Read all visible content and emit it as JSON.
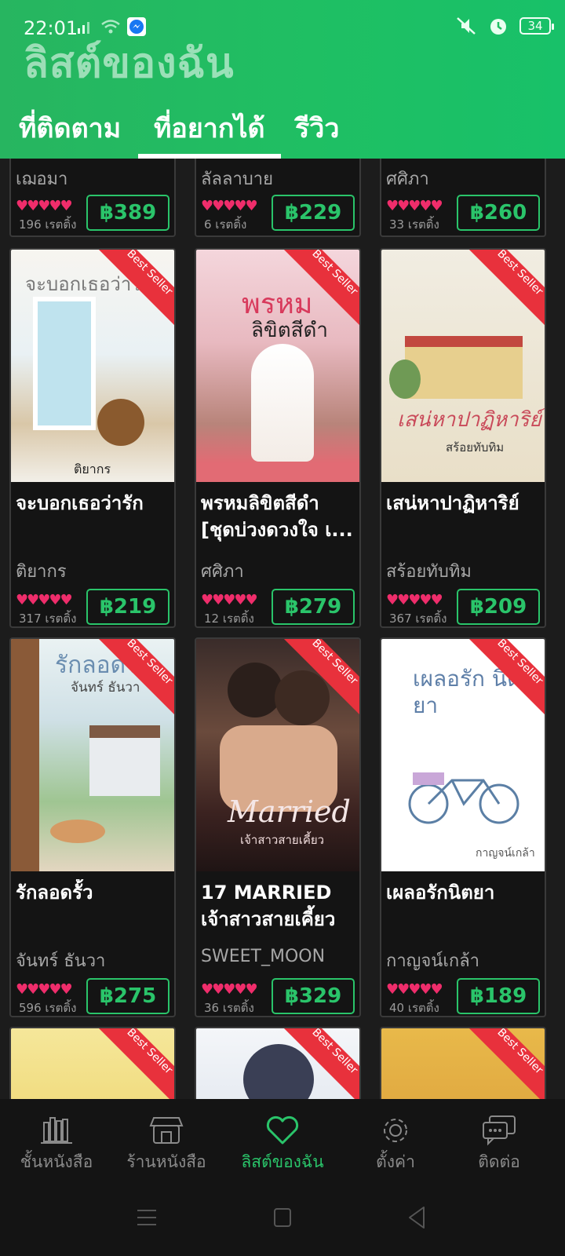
{
  "status": {
    "time": "22:01",
    "battery": "34"
  },
  "page": {
    "title": "ลิสต์ของฉัน"
  },
  "tabs": [
    {
      "label": "ที่ติดตาม"
    },
    {
      "label": "ที่อยากได้"
    },
    {
      "label": "รีวิว"
    }
  ],
  "active_tab": 1,
  "badge": "Best Seller",
  "hearts": "♥♥♥♥♥",
  "row0": [
    {
      "author": "เฌอมา",
      "ratings": "196 เรตติ้ง",
      "price": "฿389"
    },
    {
      "author": "ลัลลาบาย",
      "ratings": "6 เรตติ้ง",
      "price": "฿229"
    },
    {
      "author": "ศศิภา",
      "ratings": "33 เรตติ้ง",
      "price": "฿260"
    }
  ],
  "row1": [
    {
      "title": "จะบอกเธอว่ารัก",
      "author": "ติยากร",
      "ratings": "317 เรตติ้ง",
      "price": "฿219",
      "cover_text": "จะบอกเธอว่ารัก",
      "cover_author": "ติยากร"
    },
    {
      "title": "พรหมลิขิตสีดำ [ชุดบ่วงดวงใจ เ...",
      "author": "ศศิภา",
      "ratings": "12 เรตติ้ง",
      "price": "฿279",
      "cover_text": "พรหม",
      "cover_sub": "ลิขิตสีดำ"
    },
    {
      "title": "เสน่หาปาฏิหาริย์",
      "author": "สร้อยทับทิม",
      "ratings": "367 เรตติ้ง",
      "price": "฿209",
      "cover_text": "เสน่หาปาฏิหาริย์",
      "cover_author": "สร้อยทับทิม"
    }
  ],
  "row2": [
    {
      "title": "รักลอดรั้ว",
      "author": "จันทร์ ธันวา",
      "ratings": "596 เรตติ้ง",
      "price": "฿275",
      "cover_text": "รักลอดรั้ว",
      "cover_author": "จันทร์ ธันวา"
    },
    {
      "title": "17 MARRIED เจ้าสาวสายเคี้ยว",
      "author": "SWEET_MOON",
      "ratings": "36 เรตติ้ง",
      "price": "฿329",
      "cover_text": "Married",
      "cover_sub": "เจ้าสาวสายเคี้ยว"
    },
    {
      "title": "เผลอรักนิตยา",
      "author": "กาญจน์เกล้า",
      "ratings": "40 เรตติ้ง",
      "price": "฿189",
      "cover_text": "เผลอรัก นิตยา",
      "cover_author": "กาญจน์เกล้า"
    }
  ],
  "nav": [
    {
      "label": "ชั้นหนังสือ",
      "icon": "bookshelf-icon"
    },
    {
      "label": "ร้านหนังสือ",
      "icon": "store-icon"
    },
    {
      "label": "ลิสต์ของฉัน",
      "icon": "heart-icon"
    },
    {
      "label": "ตั้งค่า",
      "icon": "gear-icon"
    },
    {
      "label": "ติดต่อ",
      "icon": "chat-icon"
    }
  ],
  "active_nav": 2,
  "colors": {
    "accent": "#2ac46a",
    "header": "#1fbf63",
    "badge": "#e8313c",
    "heart": "#ef2d6b"
  }
}
